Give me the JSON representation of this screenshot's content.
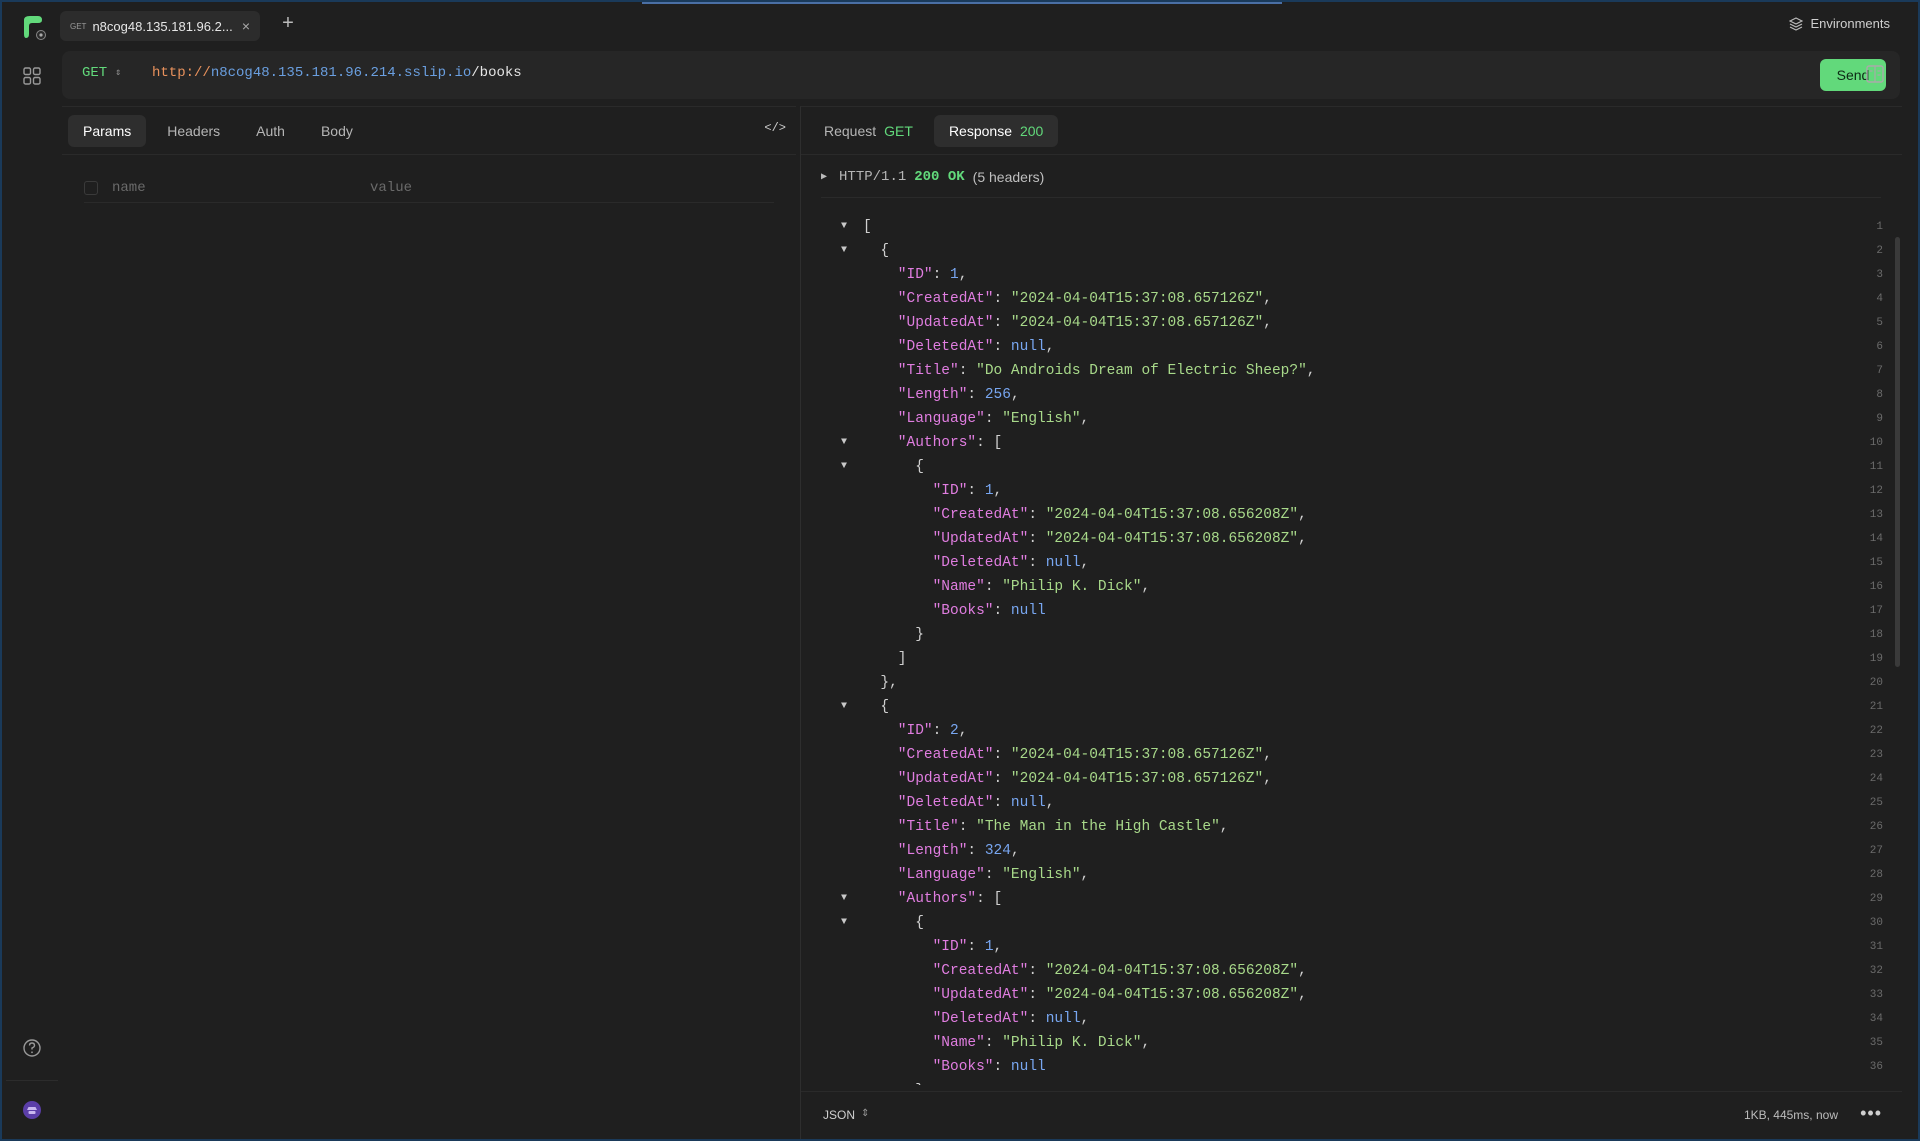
{
  "tab": {
    "method": "GET",
    "title": "n8cog48.135.181.96.2...",
    "close": "×",
    "new": "+"
  },
  "environments": {
    "label": "Environments"
  },
  "request": {
    "method": "GET",
    "url_scheme": "http://",
    "url_host": "n8cog48.135.181.96.214.sslip.io",
    "url_path": "/books",
    "send_label": "Send"
  },
  "left_tabs": [
    "Params",
    "Headers",
    "Auth",
    "Body"
  ],
  "code_toggle": "</>",
  "params": {
    "name_placeholder": "name",
    "value_placeholder": "value"
  },
  "right_tabs": {
    "request_label": "Request",
    "request_method": "GET",
    "response_label": "Response",
    "response_status": "200"
  },
  "http": {
    "version": "HTTP/1.1",
    "status": "200 OK",
    "headers": "(5 headers)"
  },
  "footer": {
    "format": "JSON",
    "meta": "1KB, 445ms, now",
    "more": "•••"
  },
  "colors": {
    "accent": "#62d97b",
    "key": "#e07de0",
    "string": "#a8d98a",
    "number": "#78a6f0"
  },
  "code_lines": [
    {
      "fold": true,
      "indent": 0,
      "key": "",
      "value": "[",
      "vtype": "p",
      "trail": ""
    },
    {
      "fold": true,
      "indent": 1,
      "key": "",
      "value": "{",
      "vtype": "p",
      "trail": ""
    },
    {
      "fold": false,
      "indent": 2,
      "key": "\"ID\"",
      "value": "1",
      "vtype": "n",
      "trail": ","
    },
    {
      "fold": false,
      "indent": 2,
      "key": "\"CreatedAt\"",
      "value": "\"2024-04-04T15:37:08.657126Z\"",
      "vtype": "s",
      "trail": ","
    },
    {
      "fold": false,
      "indent": 2,
      "key": "\"UpdatedAt\"",
      "value": "\"2024-04-04T15:37:08.657126Z\"",
      "vtype": "s",
      "trail": ","
    },
    {
      "fold": false,
      "indent": 2,
      "key": "\"DeletedAt\"",
      "value": "null",
      "vtype": "nl",
      "trail": ","
    },
    {
      "fold": false,
      "indent": 2,
      "key": "\"Title\"",
      "value": "\"Do Androids Dream of Electric Sheep?\"",
      "vtype": "s",
      "trail": ","
    },
    {
      "fold": false,
      "indent": 2,
      "key": "\"Length\"",
      "value": "256",
      "vtype": "n",
      "trail": ","
    },
    {
      "fold": false,
      "indent": 2,
      "key": "\"Language\"",
      "value": "\"English\"",
      "vtype": "s",
      "trail": ","
    },
    {
      "fold": true,
      "indent": 2,
      "key": "\"Authors\"",
      "value": "[",
      "vtype": "p",
      "trail": ""
    },
    {
      "fold": true,
      "indent": 3,
      "key": "",
      "value": "{",
      "vtype": "p",
      "trail": ""
    },
    {
      "fold": false,
      "indent": 4,
      "key": "\"ID\"",
      "value": "1",
      "vtype": "n",
      "trail": ","
    },
    {
      "fold": false,
      "indent": 4,
      "key": "\"CreatedAt\"",
      "value": "\"2024-04-04T15:37:08.656208Z\"",
      "vtype": "s",
      "trail": ","
    },
    {
      "fold": false,
      "indent": 4,
      "key": "\"UpdatedAt\"",
      "value": "\"2024-04-04T15:37:08.656208Z\"",
      "vtype": "s",
      "trail": ","
    },
    {
      "fold": false,
      "indent": 4,
      "key": "\"DeletedAt\"",
      "value": "null",
      "vtype": "nl",
      "trail": ","
    },
    {
      "fold": false,
      "indent": 4,
      "key": "\"Name\"",
      "value": "\"Philip K. Dick\"",
      "vtype": "s",
      "trail": ","
    },
    {
      "fold": false,
      "indent": 4,
      "key": "\"Books\"",
      "value": "null",
      "vtype": "nl",
      "trail": ""
    },
    {
      "fold": false,
      "indent": 3,
      "key": "",
      "value": "}",
      "vtype": "p",
      "trail": ""
    },
    {
      "fold": false,
      "indent": 2,
      "key": "",
      "value": "]",
      "vtype": "p",
      "trail": ""
    },
    {
      "fold": false,
      "indent": 1,
      "key": "",
      "value": "}",
      "vtype": "p",
      "trail": ","
    },
    {
      "fold": true,
      "indent": 1,
      "key": "",
      "value": "{",
      "vtype": "p",
      "trail": ""
    },
    {
      "fold": false,
      "indent": 2,
      "key": "\"ID\"",
      "value": "2",
      "vtype": "n",
      "trail": ","
    },
    {
      "fold": false,
      "indent": 2,
      "key": "\"CreatedAt\"",
      "value": "\"2024-04-04T15:37:08.657126Z\"",
      "vtype": "s",
      "trail": ","
    },
    {
      "fold": false,
      "indent": 2,
      "key": "\"UpdatedAt\"",
      "value": "\"2024-04-04T15:37:08.657126Z\"",
      "vtype": "s",
      "trail": ","
    },
    {
      "fold": false,
      "indent": 2,
      "key": "\"DeletedAt\"",
      "value": "null",
      "vtype": "nl",
      "trail": ","
    },
    {
      "fold": false,
      "indent": 2,
      "key": "\"Title\"",
      "value": "\"The Man in the High Castle\"",
      "vtype": "s",
      "trail": ","
    },
    {
      "fold": false,
      "indent": 2,
      "key": "\"Length\"",
      "value": "324",
      "vtype": "n",
      "trail": ","
    },
    {
      "fold": false,
      "indent": 2,
      "key": "\"Language\"",
      "value": "\"English\"",
      "vtype": "s",
      "trail": ","
    },
    {
      "fold": true,
      "indent": 2,
      "key": "\"Authors\"",
      "value": "[",
      "vtype": "p",
      "trail": ""
    },
    {
      "fold": true,
      "indent": 3,
      "key": "",
      "value": "{",
      "vtype": "p",
      "trail": ""
    },
    {
      "fold": false,
      "indent": 4,
      "key": "\"ID\"",
      "value": "1",
      "vtype": "n",
      "trail": ","
    },
    {
      "fold": false,
      "indent": 4,
      "key": "\"CreatedAt\"",
      "value": "\"2024-04-04T15:37:08.656208Z\"",
      "vtype": "s",
      "trail": ","
    },
    {
      "fold": false,
      "indent": 4,
      "key": "\"UpdatedAt\"",
      "value": "\"2024-04-04T15:37:08.656208Z\"",
      "vtype": "s",
      "trail": ","
    },
    {
      "fold": false,
      "indent": 4,
      "key": "\"DeletedAt\"",
      "value": "null",
      "vtype": "nl",
      "trail": ","
    },
    {
      "fold": false,
      "indent": 4,
      "key": "\"Name\"",
      "value": "\"Philip K. Dick\"",
      "vtype": "s",
      "trail": ","
    },
    {
      "fold": false,
      "indent": 4,
      "key": "\"Books\"",
      "value": "null",
      "vtype": "nl",
      "trail": ""
    },
    {
      "fold": false,
      "indent": 3,
      "key": "",
      "value": "}",
      "vtype": "p",
      "trail": ""
    }
  ]
}
